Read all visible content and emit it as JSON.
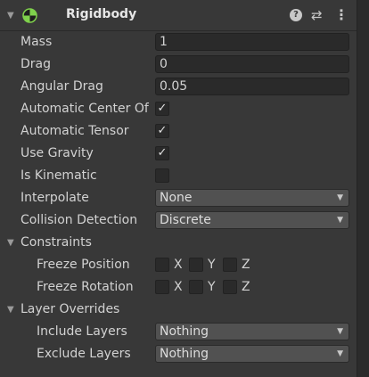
{
  "component": {
    "title": "Rigidbody",
    "enabled": true
  },
  "header_icons": {
    "help": "?",
    "presets": "⇄",
    "menu": "⋮"
  },
  "fields": {
    "mass": {
      "label": "Mass",
      "value": "1"
    },
    "drag": {
      "label": "Drag",
      "value": "0"
    },
    "angular_drag": {
      "label": "Angular Drag",
      "value": "0.05"
    },
    "automatic_center_of_mass": {
      "label": "Automatic Center Of",
      "checked": true
    },
    "automatic_tensor": {
      "label": "Automatic Tensor",
      "checked": true
    },
    "use_gravity": {
      "label": "Use Gravity",
      "checked": true
    },
    "is_kinematic": {
      "label": "Is Kinematic",
      "checked": false
    },
    "interpolate": {
      "label": "Interpolate",
      "value": "None"
    },
    "collision_detection": {
      "label": "Collision Detection",
      "value": "Discrete"
    }
  },
  "constraints": {
    "label": "Constraints",
    "freeze_position": {
      "label": "Freeze Position",
      "x": "X",
      "y": "Y",
      "z": "Z",
      "x_checked": false,
      "y_checked": false,
      "z_checked": false
    },
    "freeze_rotation": {
      "label": "Freeze Rotation",
      "x": "X",
      "y": "Y",
      "z": "Z",
      "x_checked": false,
      "y_checked": false,
      "z_checked": false
    }
  },
  "layer_overrides": {
    "label": "Layer Overrides",
    "include_layers": {
      "label": "Include Layers",
      "value": "Nothing"
    },
    "exclude_layers": {
      "label": "Exclude Layers",
      "value": "Nothing"
    }
  },
  "glyphs": {
    "check": "✓",
    "dropdown_arrow": "▼",
    "expanded_arrow": "▼"
  }
}
